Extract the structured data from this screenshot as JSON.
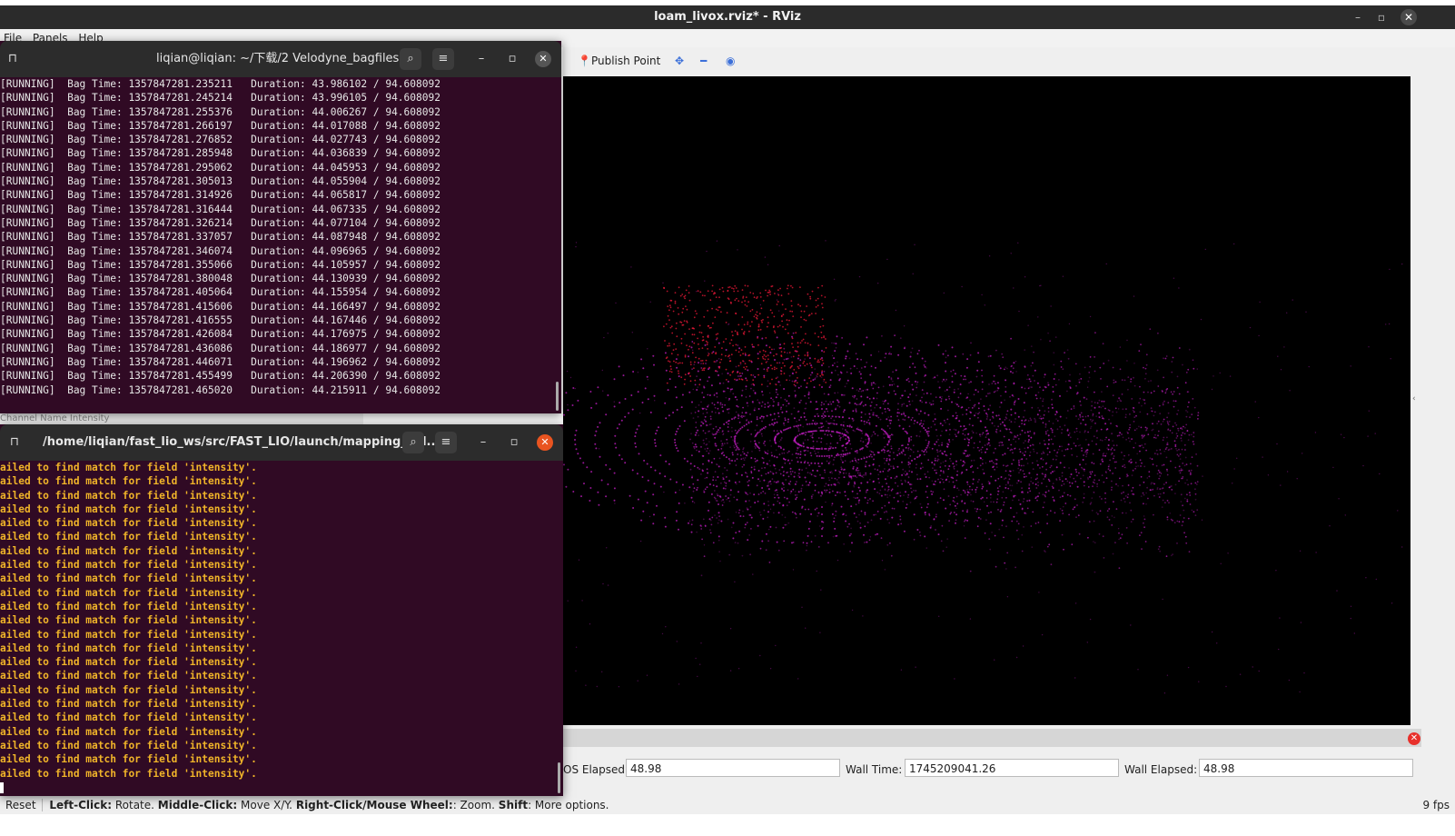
{
  "window": {
    "title": "loam_livox.rviz* - RViz"
  },
  "menu": [
    "File",
    "Panels",
    "Help"
  ],
  "toolbar": {
    "publish_point": "Publish Point"
  },
  "time_panel": {
    "ros_elapsed_label": "ROS Elapsed:",
    "ros_elapsed_visible_label": "OS Elapsed:",
    "ros_elapsed": "48.98",
    "wall_time_label": "Wall Time:",
    "wall_time": "1745209041.26",
    "wall_elapsed_label": "Wall Elapsed:",
    "wall_elapsed": "48.98"
  },
  "status": {
    "reset": "Reset",
    "left_click": "Left-Click:",
    "left_click_desc": "Rotate.",
    "middle_click": "Middle-Click:",
    "middle_click_desc": "Move X/Y.",
    "right_click": "Right-Click/Mouse Wheel:",
    "right_click_desc": ": Zoom.",
    "shift": "Shift",
    "shift_desc": ": More options.",
    "fps": "9 fps"
  },
  "behind_text": "Channel Name                    Intensity",
  "terminal1": {
    "title": "liqian@liqian: ~/下载/2 Velodyne_bagfiles",
    "lines": [
      "[RUNNING]  Bag Time: 1357847281.235211   Duration: 43.986102 / 94.608092",
      "[RUNNING]  Bag Time: 1357847281.245214   Duration: 43.996105 / 94.608092",
      "[RUNNING]  Bag Time: 1357847281.255376   Duration: 44.006267 / 94.608092",
      "[RUNNING]  Bag Time: 1357847281.266197   Duration: 44.017088 / 94.608092",
      "[RUNNING]  Bag Time: 1357847281.276852   Duration: 44.027743 / 94.608092",
      "[RUNNING]  Bag Time: 1357847281.285948   Duration: 44.036839 / 94.608092",
      "[RUNNING]  Bag Time: 1357847281.295062   Duration: 44.045953 / 94.608092",
      "[RUNNING]  Bag Time: 1357847281.305013   Duration: 44.055904 / 94.608092",
      "[RUNNING]  Bag Time: 1357847281.314926   Duration: 44.065817 / 94.608092",
      "[RUNNING]  Bag Time: 1357847281.316444   Duration: 44.067335 / 94.608092",
      "[RUNNING]  Bag Time: 1357847281.326214   Duration: 44.077104 / 94.608092",
      "[RUNNING]  Bag Time: 1357847281.337057   Duration: 44.087948 / 94.608092",
      "[RUNNING]  Bag Time: 1357847281.346074   Duration: 44.096965 / 94.608092",
      "[RUNNING]  Bag Time: 1357847281.355066   Duration: 44.105957 / 94.608092",
      "[RUNNING]  Bag Time: 1357847281.380048   Duration: 44.130939 / 94.608092",
      "[RUNNING]  Bag Time: 1357847281.405064   Duration: 44.155954 / 94.608092",
      "[RUNNING]  Bag Time: 1357847281.415606   Duration: 44.166497 / 94.608092",
      "[RUNNING]  Bag Time: 1357847281.416555   Duration: 44.167446 / 94.608092",
      "[RUNNING]  Bag Time: 1357847281.426084   Duration: 44.176975 / 94.608092",
      "[RUNNING]  Bag Time: 1357847281.436086   Duration: 44.186977 / 94.608092",
      "[RUNNING]  Bag Time: 1357847281.446071   Duration: 44.196962 / 94.608092",
      "[RUNNING]  Bag Time: 1357847281.455499   Duration: 44.206390 / 94.608092",
      "[RUNNING]  Bag Time: 1357847281.465020   Duration: 44.215911 / 94.608092"
    ]
  },
  "terminal2": {
    "title": "/home/liqian/fast_lio_ws/src/FAST_LIO/launch/mapping_vel...",
    "lines": [
      "ailed to find match for field 'intensity'.",
      "ailed to find match for field 'intensity'.",
      "ailed to find match for field 'intensity'.",
      "ailed to find match for field 'intensity'.",
      "ailed to find match for field 'intensity'.",
      "ailed to find match for field 'intensity'.",
      "ailed to find match for field 'intensity'.",
      "ailed to find match for field 'intensity'.",
      "ailed to find match for field 'intensity'.",
      "ailed to find match for field 'intensity'.",
      "ailed to find match for field 'intensity'.",
      "ailed to find match for field 'intensity'.",
      "ailed to find match for field 'intensity'.",
      "ailed to find match for field 'intensity'.",
      "ailed to find match for field 'intensity'.",
      "ailed to find match for field 'intensity'.",
      "ailed to find match for field 'intensity'.",
      "ailed to find match for field 'intensity'.",
      "ailed to find match for field 'intensity'.",
      "ailed to find match for field 'intensity'.",
      "ailed to find match for field 'intensity'.",
      "ailed to find match for field 'intensity'.",
      "ailed to find match for field 'intensity'."
    ]
  },
  "colors": {
    "terminal_bg": "#300a24",
    "warn_text": "#f0b429",
    "cloud_main": "#d11fd1",
    "cloud_accent": "#ff1a3c",
    "close_orange": "#e95420"
  },
  "icons": [
    "pin-icon",
    "move-camera-icon",
    "zoom-out-icon",
    "eye-icon",
    "search-icon",
    "hamburger-icon",
    "minimize-icon",
    "maximize-icon",
    "close-icon",
    "terminal-tab-icon"
  ]
}
